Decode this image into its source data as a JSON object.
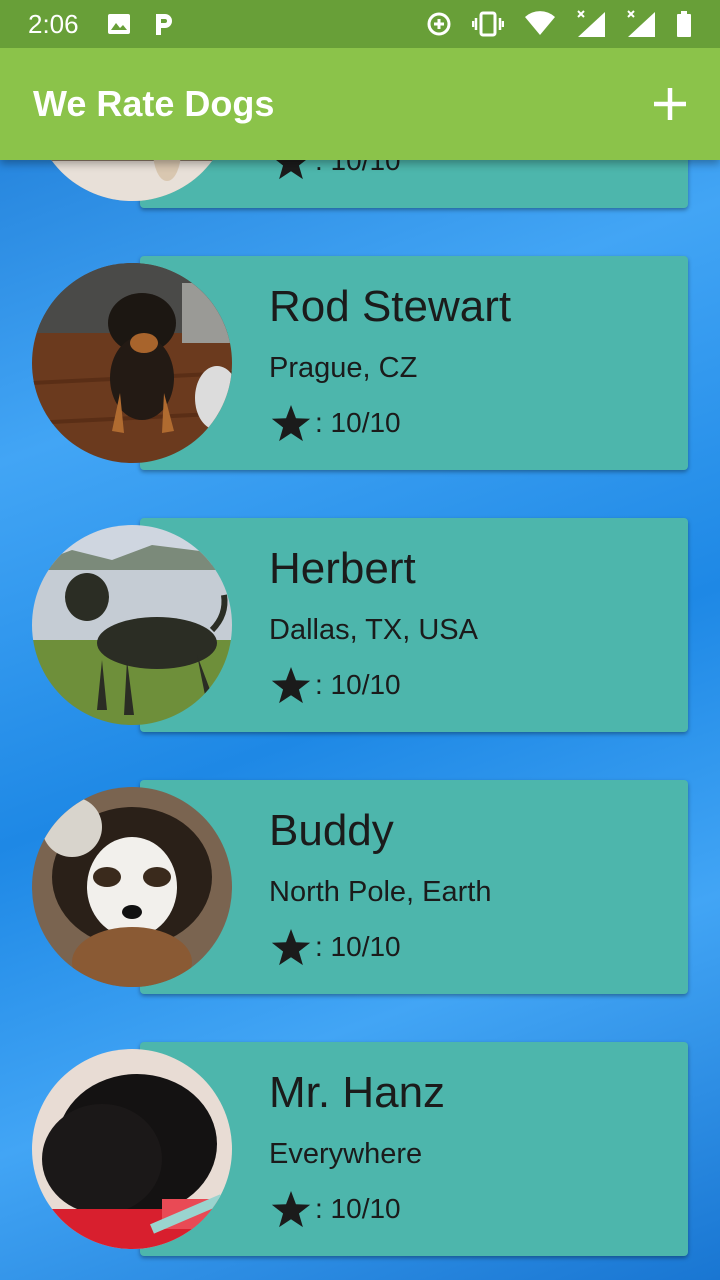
{
  "status_bar": {
    "time": "2:06",
    "left_icons": [
      "image-icon",
      "parking-icon"
    ],
    "right_icons": [
      "data-saver-icon",
      "vibrate-icon",
      "wifi-icon",
      "signal-icon",
      "signal-icon",
      "battery-icon"
    ]
  },
  "app_bar": {
    "title": "We Rate Dogs",
    "add_icon": "add-icon"
  },
  "dogs": [
    {
      "name": "",
      "location": "",
      "rating": ": 10/10"
    },
    {
      "name": "Rod Stewart",
      "location": "Prague, CZ",
      "rating": ": 10/10"
    },
    {
      "name": "Herbert",
      "location": "Dallas, TX, USA",
      "rating": ": 10/10"
    },
    {
      "name": "Buddy",
      "location": "North Pole, Earth",
      "rating": ": 10/10"
    },
    {
      "name": "Mr. Hanz",
      "location": "Everywhere",
      "rating": ": 10/10"
    }
  ],
  "colors": {
    "status_bar": "#689f38",
    "app_bar": "#8bc34a",
    "card": "#4db6ac",
    "background": "#1e88e5"
  }
}
